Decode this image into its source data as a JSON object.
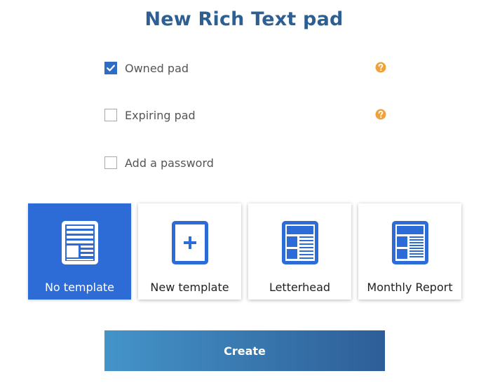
{
  "title": "New Rich Text pad",
  "options": [
    {
      "label": "Owned pad",
      "checked": true,
      "has_help": true
    },
    {
      "label": "Expiring pad",
      "checked": false,
      "has_help": true
    },
    {
      "label": "Add a password",
      "checked": false,
      "has_help": false
    }
  ],
  "templates": [
    {
      "label": "No template",
      "icon": "document-lines-icon",
      "selected": true
    },
    {
      "label": "New template",
      "icon": "plus-square-icon",
      "selected": false
    },
    {
      "label": "Letterhead",
      "icon": "letterhead-icon",
      "selected": false
    },
    {
      "label": "Monthly Report",
      "icon": "report-icon",
      "selected": false
    }
  ],
  "create_label": "Create",
  "colors": {
    "title": "#2d5f92",
    "accent_blue": "#2d6bd6",
    "help_orange": "#f0a13a",
    "button_gradient_start": "#4494c9",
    "button_gradient_end": "#2e5e97"
  }
}
